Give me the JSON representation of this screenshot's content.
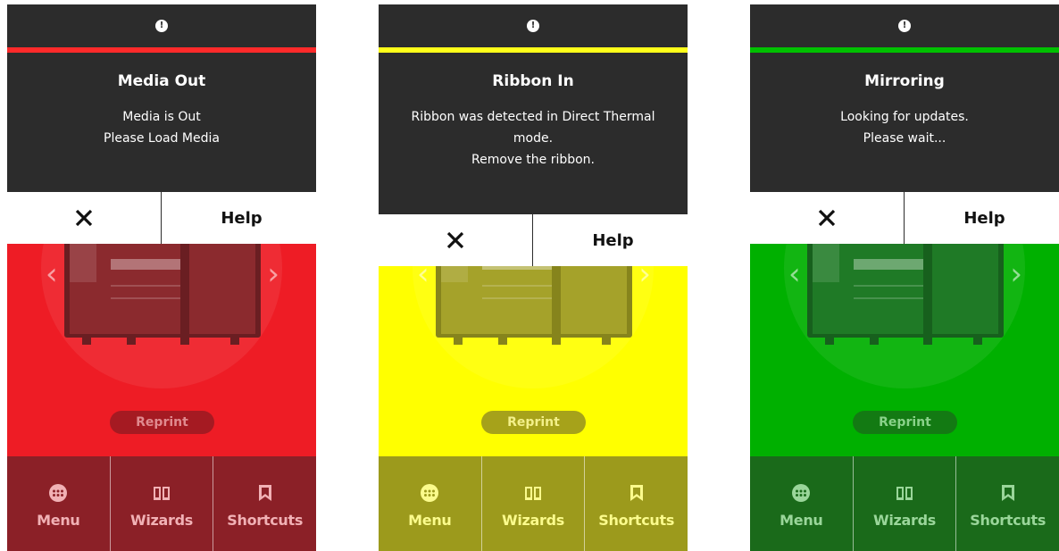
{
  "screens": [
    {
      "alert_title": "Media Out",
      "alert_lines": [
        "Media is Out",
        "Please Load Media"
      ],
      "close_label": "✕",
      "help_label": "Help",
      "reprint_label": "Reprint",
      "nav": [
        "Menu",
        "Wizards",
        "Shortcuts"
      ],
      "colors": {
        "body": "#ee1c25",
        "bar": "#8b2027",
        "line": "#ff2a2a",
        "reprint_bg": "#a51a22",
        "reprint_text": "#e08a8f",
        "nav_text": "#f1b1b5",
        "printer": "#8b2a2e",
        "printer_dark": "#6a1e22"
      }
    },
    {
      "alert_title": "Ribbon In",
      "alert_lines": [
        "Ribbon was detected in Direct Thermal",
        "mode.",
        "Remove the ribbon."
      ],
      "close_label": "✕",
      "help_label": "Help",
      "reprint_label": "Reprint",
      "nav": [
        "Menu",
        "Wizards",
        "Shortcuts"
      ],
      "colors": {
        "body": "#ffff00",
        "bar": "#9c9a1c",
        "line": "#ffff1a",
        "reprint_bg": "#a6a21a",
        "reprint_text": "#f3f08a",
        "nav_text": "#fbfb8c",
        "printer": "#a5a22a",
        "printer_dark": "#86841c"
      }
    },
    {
      "alert_title": "Mirroring",
      "alert_lines": [
        "Looking for updates.",
        "Please wait..."
      ],
      "close_label": "✕",
      "help_label": "Help",
      "reprint_label": "Reprint",
      "nav": [
        "Menu",
        "Wizards",
        "Shortcuts"
      ],
      "colors": {
        "body": "#00b000",
        "bar": "#1a6a1a",
        "line": "#00c000",
        "reprint_bg": "#137a13",
        "reprint_text": "#8ad28a",
        "nav_text": "#9ad69a",
        "printer": "#1f7a26",
        "printer_dark": "#17601d"
      }
    }
  ],
  "info_icon": "info-circle-icon",
  "nav_icons": [
    "dots-menu-icon",
    "book-icon",
    "bookmark-icon"
  ]
}
